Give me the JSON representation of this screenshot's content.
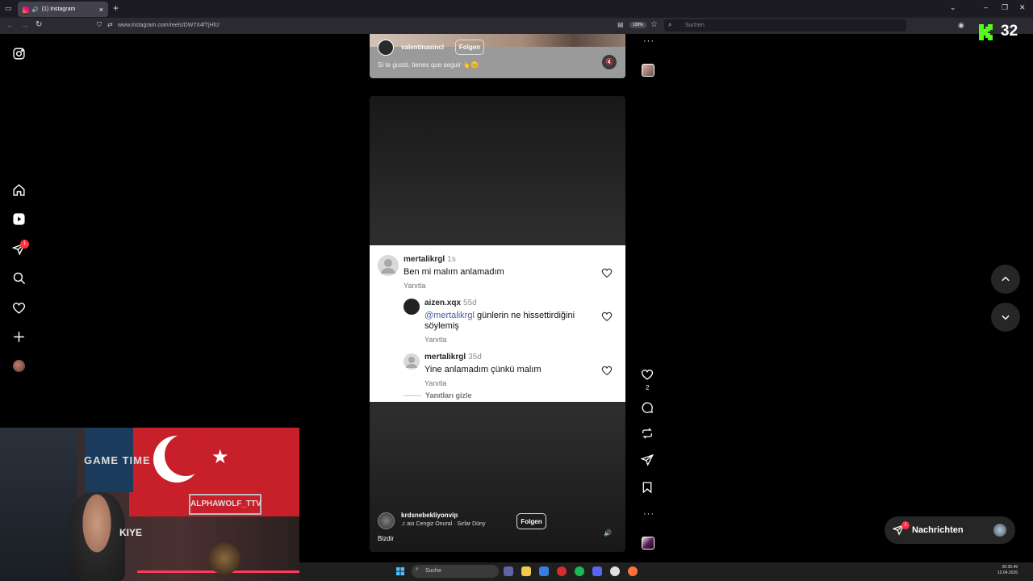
{
  "browser": {
    "tab_title": "(1) Instagram",
    "url": "www.instagram.com/reels/DW7X4fTjHfc/",
    "zoom": "130%",
    "search_placeholder": "Suchen",
    "newtab": "+"
  },
  "kick": {
    "count": "32"
  },
  "reel_prev": {
    "username": "valentinasincl",
    "follow_label": "Folgen",
    "caption": "Si te gustó, tienes que seguir 👆😊"
  },
  "comments": [
    {
      "user": "mertalikrgl",
      "time": "1s",
      "text": "Ben mi malım anlamadım",
      "reply": "Yanıtla"
    },
    {
      "user": "aizen.xqx",
      "time": "55d",
      "mention": "@mertalikrgl",
      "text": " günlerin ne hissettirdiğini söylemiş",
      "reply": "Yanıtla"
    },
    {
      "user": "mertalikrgl",
      "time": "35d",
      "text": "Yine anlamadım çünkü malım",
      "reply": "Yanıtla"
    }
  ],
  "hide_replies": "Yanıtları gizle",
  "reel": {
    "username": "krdsnebekliyonvip",
    "audio": "♫ ası       Cengiz Onural · Sırlar Düny",
    "follow_label": "Folgen",
    "caption": "Bizdir",
    "like_count": "2"
  },
  "messages": {
    "label": "Nachrichten",
    "badge": "1"
  },
  "notifications_badge": "1",
  "webcam": {
    "sign_game": "GAME TIME",
    "sign_alpha": "ALPHAWOLF_TTV",
    "shirt": "KIYE"
  },
  "taskbar": {
    "search": "Suche",
    "time": "00:35:49",
    "date": "10.04.2026"
  },
  "colors": {
    "accent_badge": "#ff3040",
    "kick_green": "#53fc18"
  }
}
